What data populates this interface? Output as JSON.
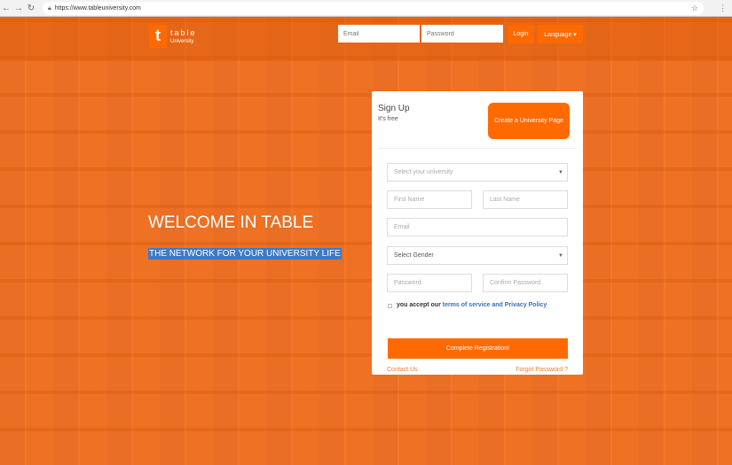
{
  "browser": {
    "url": "https://www.tableuniversity.com"
  },
  "header": {
    "logo_letter": "t",
    "brand": "table",
    "brand_sub": "University",
    "email_placeholder": "Email",
    "password_placeholder": "Password",
    "login": "Login",
    "language": "Language ▾"
  },
  "hero": {
    "title": "WELCOME IN TABLE",
    "tagline": "THE NETWORK FOR YOUR UNIVERSITY LIFE"
  },
  "signup": {
    "title": "Sign Up",
    "subtitle": "It's free",
    "create_page": "Create a University Page",
    "university_placeholder": "Select your university",
    "first_name": "First Name",
    "last_name": "Last Name",
    "email": "Email",
    "gender": "Select Gender",
    "password": "Password",
    "confirm_password": "Confirm Password",
    "accept_text": "you accept our ",
    "terms_link": "terms of service and Privacy Policy",
    "submit": "Complete Registration!",
    "contact": "Contact Us",
    "forgot": "Forgot Password ?"
  }
}
